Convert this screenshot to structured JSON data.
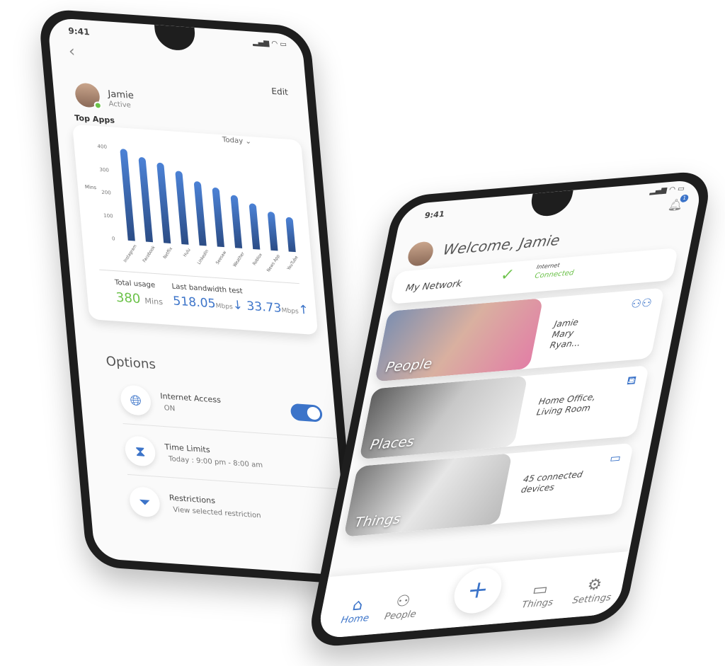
{
  "left_phone": {
    "time": "9:41",
    "edit": "Edit",
    "user_name": "Jamie",
    "user_status": "Active",
    "section_title": "Top Apps",
    "period": "Today",
    "chart_data": {
      "type": "bar",
      "ylabel": "Mins",
      "ylim": [
        0,
        400
      ],
      "yticks": [
        "0",
        "100",
        "200",
        "300",
        "400"
      ],
      "categories": [
        "Instagram",
        "Facebook",
        "Netflix",
        "Hulu",
        "LinkedIn",
        "Seesaw",
        "Weather",
        "Roblox",
        "News App",
        "YouTube"
      ],
      "values": [
        400,
        370,
        350,
        320,
        280,
        260,
        230,
        200,
        170,
        150
      ],
      "color": "#3c74c9"
    },
    "total_usage_label": "Total usage",
    "total_usage_value": "380",
    "total_usage_unit": "Mins",
    "bandwidth_label": "Last bandwidth test",
    "download": "518.05",
    "upload": "33.73",
    "unit": "Mbps",
    "options_title": "Options",
    "options": [
      {
        "title": "Internet Access",
        "sub": "ON",
        "icon": "globe-icon",
        "toggle": true
      },
      {
        "title": "Time Limits",
        "sub": "Today : 9:00 pm - 8:00 am",
        "icon": "hourglass-icon"
      },
      {
        "title": "Restrictions",
        "sub": "View selected restriction",
        "icon": "filter-icon"
      }
    ]
  },
  "right_phone": {
    "time": "9:41",
    "notification_count": "1",
    "welcome": "Welcome, Jamie",
    "network_label": "My Network",
    "internet_label": "Internet",
    "internet_status": "Connected",
    "tiles": [
      {
        "label": "People",
        "detail": [
          "Jamie",
          "Mary",
          "Ryan..."
        ],
        "icon": "people-icon"
      },
      {
        "label": "Places",
        "detail": [
          "Home Office,",
          "Living Room"
        ],
        "icon": "sofa-icon"
      },
      {
        "label": "Things",
        "detail": [
          "45 connected",
          "devices"
        ],
        "icon": "devices-icon"
      }
    ],
    "nav": [
      {
        "label": "Home",
        "active": true
      },
      {
        "label": "People"
      },
      {
        "label": "Things"
      },
      {
        "label": "Settings"
      }
    ],
    "accent": "#3c74c9",
    "connected_color": "#6cc24a"
  }
}
